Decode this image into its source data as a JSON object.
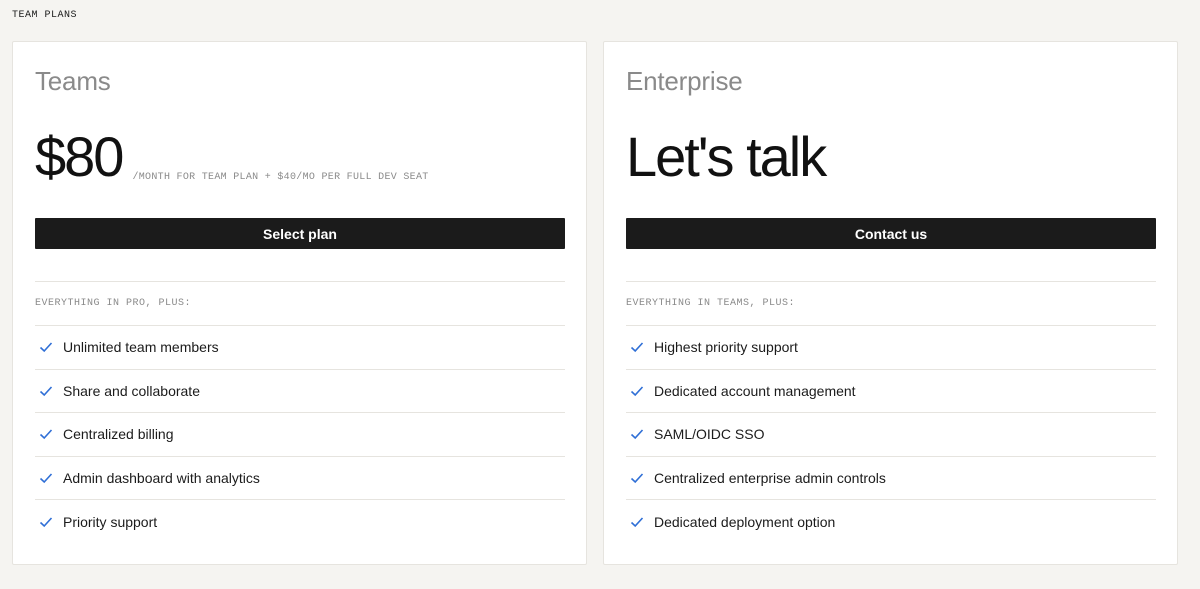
{
  "section": {
    "title": "TEAM PLANS"
  },
  "colors": {
    "accent_check": "#2f6fd6",
    "button_bg": "#1b1b1b",
    "page_bg": "#f5f4f1"
  },
  "plans": [
    {
      "name": "Teams",
      "price": "$80",
      "price_note": "/MONTH FOR TEAM PLAN + $40/MO PER FULL DEV SEAT",
      "cta_label": "Select plan",
      "features_heading": "EVERYTHING IN PRO, PLUS:",
      "features": [
        "Unlimited team members",
        "Share and collaborate",
        "Centralized billing",
        "Admin dashboard with analytics",
        "Priority support"
      ]
    },
    {
      "name": "Enterprise",
      "price": "Let's talk",
      "price_note": "",
      "cta_label": "Contact us",
      "features_heading": "EVERYTHING IN TEAMS, PLUS:",
      "features": [
        "Highest priority support",
        "Dedicated account management",
        "SAML/OIDC SSO",
        "Centralized enterprise admin controls",
        "Dedicated deployment option"
      ]
    }
  ],
  "icons": {
    "feature_check": "check-icon"
  }
}
